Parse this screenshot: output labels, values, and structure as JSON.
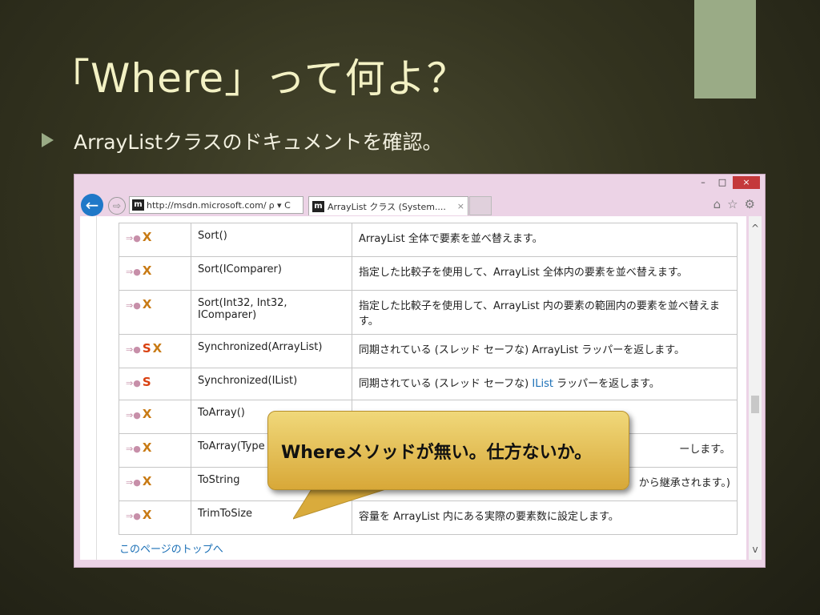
{
  "slide": {
    "title": "「Where」って何よ？",
    "bullet": "ArrayListクラスのドキュメントを確認。"
  },
  "browser": {
    "window_controls": {
      "minimize": "–",
      "maximize": "□",
      "close": "×"
    },
    "address_icon": "m",
    "address_text": "http://msdn.microsoft.com/",
    "address_glyphs": "ρ ▾ C",
    "tab_icon": "m",
    "tab_title": "ArrayList クラス (System....",
    "tab_close": "×",
    "icons": [
      "home-icon",
      "favorites-icon",
      "settings-icon"
    ]
  },
  "table": {
    "rows": [
      {
        "flags": "pink-x",
        "name": "Sort()",
        "desc": "ArrayList 全体で要素を並べ替えます。"
      },
      {
        "flags": "pink-x",
        "name": "Sort(IComparer)",
        "desc": "指定した比較子を使用して、ArrayList 全体内の要素を並べ替えます。"
      },
      {
        "flags": "pink-x",
        "name": "Sort(Int32, Int32, IComparer)",
        "desc": "指定した比較子を使用して、ArrayList 内の要素の範囲内の要素を並べ替えます。"
      },
      {
        "flags": "pink-s-x",
        "name": "Synchronized(ArrayList)",
        "desc": "同期されている (スレッド セーフな) ArrayList ラッパーを返します。"
      },
      {
        "flags": "pink-s",
        "name": "Synchronized(IList)",
        "desc_pre": "同期されている (スレッド セーフな) ",
        "desc_link": "IList",
        "desc_post": " ラッパーを返します。"
      },
      {
        "flags": "pink-x",
        "name": "ToArray()",
        "desc": ""
      },
      {
        "flags": "pink-x",
        "name": "ToArray(Type",
        "desc": "ーします。"
      },
      {
        "flags": "pink-x",
        "name": "ToString",
        "desc": "から継承されます。)"
      },
      {
        "flags": "pink-x",
        "name": "TrimToSize",
        "desc": "容量を ArrayList 内にある実際の要素数に設定します。"
      }
    ],
    "top_link": "このページのトップへ"
  },
  "callout": {
    "text": "Whereメソッドが無い。仕方ないか。"
  }
}
